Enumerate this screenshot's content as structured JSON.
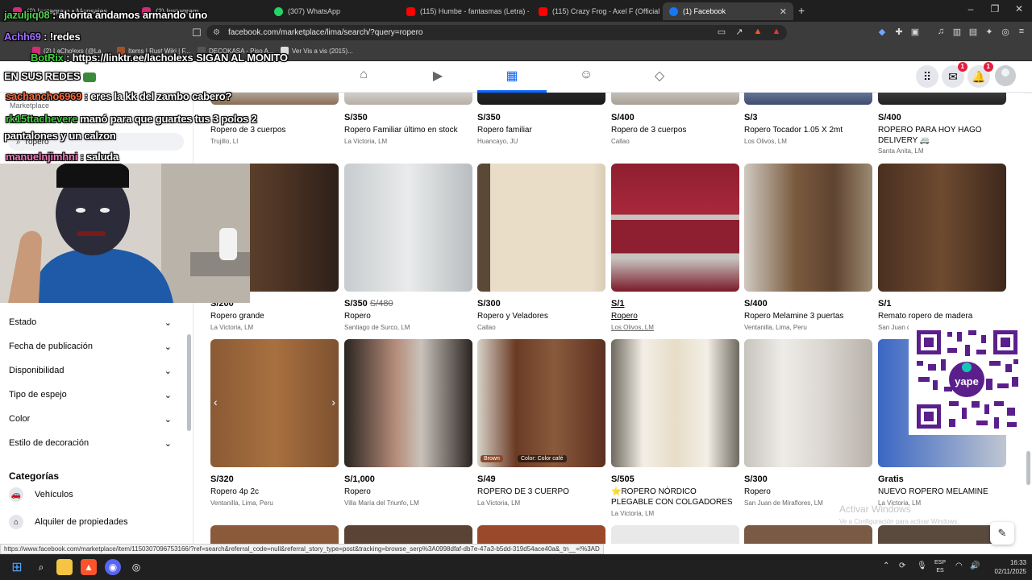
{
  "browser": {
    "tabs": [
      {
        "label": "(2) Instagram • Mensajes",
        "color": "#d62976"
      },
      {
        "label": "(2) Instagram",
        "color": "#d62976"
      },
      {
        "label": "(307) WhatsApp",
        "color": "#25d366"
      },
      {
        "label": "(115) Humbe - fantasmas (Letra) - Yo",
        "color": "#ff0000"
      },
      {
        "label": "(115) Crazy Frog - Axel F (Official Vid",
        "color": "#ff0000"
      },
      {
        "label": "(1) Facebook",
        "color": "#1877f2",
        "active": true
      }
    ],
    "url": "facebook.com/marketplace/lima/search/?query=ropero",
    "bookmarks": [
      {
        "label": "(2) LaCholexs (@La..."
      },
      {
        "label": "Items | Rust Wiki | F..."
      },
      {
        "label": "DECOKASA - Piso A..."
      },
      {
        "label": "Ver Vis a vis (2015)..."
      }
    ]
  },
  "facebook": {
    "nav_icons": [
      "home-icon",
      "video-icon",
      "marketplace-icon",
      "groups-icon",
      "gaming-icon"
    ],
    "header_buttons": [
      {
        "name": "menu-grid",
        "badge": ""
      },
      {
        "name": "messenger",
        "badge": "1"
      },
      {
        "name": "notifications",
        "badge": "1"
      }
    ],
    "accent": "#0866ff"
  },
  "sidebar": {
    "marketplace_label": "Marketplace",
    "search_value": "ropero",
    "filters": [
      "Estado",
      "Fecha de publicación",
      "Disponibilidad",
      "Tipo de espejo",
      "Color",
      "Estilo de decoración"
    ],
    "categories_heading": "Categorías",
    "categories": [
      {
        "label": "Vehículos",
        "icon": "car-icon"
      },
      {
        "label": "Alquiler de propiedades",
        "icon": "house-icon"
      }
    ]
  },
  "listings_rows": [
    [
      {
        "price": "",
        "title": "Ropero de 3 cuerpos",
        "location": "Trujillo, LI"
      },
      {
        "price": "S/350",
        "title": "Ropero Familiar último en stock",
        "location": "La Victoria, LM"
      },
      {
        "price": "S/350",
        "title": "Ropero familiar",
        "location": "Huancayo, JU"
      },
      {
        "price": "S/400",
        "title": "Ropero de 3 cuerpos",
        "location": "Callao"
      },
      {
        "price": "S/3",
        "title": "Ropero Tocador 1.05 X 2mt",
        "location": "Los Olivos, LM"
      },
      {
        "price": "S/400",
        "title": "ROPERO PARA HOY HAGO DELIVERY 🚐",
        "location": "Santa Anita, LM"
      }
    ],
    [
      {
        "price": "S/200",
        "title": "Ropero grande",
        "location": "La Victoria, LM"
      },
      {
        "price": "S/350",
        "old_price": "S/480",
        "title": "Ropero",
        "location": "Santiago de Surco, LM"
      },
      {
        "price": "S/300",
        "title": "Ropero y Veladores",
        "location": "Callao"
      },
      {
        "price": "S/1",
        "title": "Ropero",
        "location": "Los Olivos, LM",
        "hovered": true
      },
      {
        "price": "S/400",
        "title": "Ropero Melamine 3 puertas",
        "location": "Ventanilla, Lima, Peru"
      },
      {
        "price": "S/1",
        "title": "Remato ropero de madera",
        "location": "San Juan d"
      }
    ],
    [
      {
        "price": "S/320",
        "title": "Ropero 4p 2c",
        "location": "Ventanilla, Lima, Peru"
      },
      {
        "price": "S/1,000",
        "title": "Ropero",
        "location": "Villa María del Triunfo, LM"
      },
      {
        "price": "S/49",
        "title": "ROPERO DE 3 CUERPO",
        "location": "La Victoria, LM",
        "chips": [
          "Brown",
          "Color: Color café"
        ]
      },
      {
        "price": "S/505",
        "title": "⭐ROPERO NÓRDICO PLEGABLE CON COLGADORES",
        "location": "La Victoria, LM"
      },
      {
        "price": "S/300",
        "title": "Ropero",
        "location": "San Juan de Miraflores, LM"
      },
      {
        "price": "Gratis",
        "title": "NUEVO ROPERO MELAMINE",
        "location": "La Victoria, LM"
      }
    ]
  ],
  "windows_watermark": {
    "title": "Activar Windows",
    "subtitle": "Ve a Configuración para activar Windows."
  },
  "status_url": "https://www.facebook.com/marketplace/item/1150307096753166/?ref=search&referral_code=null&referral_story_type=post&tracking=browse_serp%3A0998dfaf-db7e-47a3-b5dd-319d54ace40a&_tn__=!%3AD",
  "taskbar": {
    "lang": "ESP",
    "lang_sub": "ES",
    "time": "16:33",
    "date": "02/11/2025"
  },
  "overlay": {
    "chat": [
      {
        "user": "jazuljiq08",
        "sep": " : ",
        "message": "ahorita andamos armando uno",
        "color": "#4dd34d"
      },
      {
        "user": "Achh69",
        "sep": " : ",
        "message": "!redes",
        "color": "#a070ff"
      },
      {
        "user": "BotRix",
        "sep": " : ",
        "message": "https://linktr.ee/lacholexs SIGAN AL MONITO",
        "color": "#3ad13a"
      },
      {
        "user": "EN SUS REDES",
        "sep": "",
        "message": "",
        "color": "#ffffff"
      },
      {
        "user": "sachancho6969",
        "sep": " : ",
        "message": "eres la kk del zambo cabero?",
        "color": "#ff6b3d"
      },
      {
        "user": "rk15ttachevere",
        "sep": " ",
        "message": "manó para que guartes tus 3 polos 2",
        "color": "#3ad13a"
      },
      {
        "user": "",
        "sep": "",
        "message": "pantalones y un calzon",
        "color": "#ffffff"
      },
      {
        "user": "manuelnjimhni",
        "sep": " : ",
        "message": "saluda",
        "color": "#ff7ac6"
      }
    ],
    "qr_caption": "yape"
  }
}
